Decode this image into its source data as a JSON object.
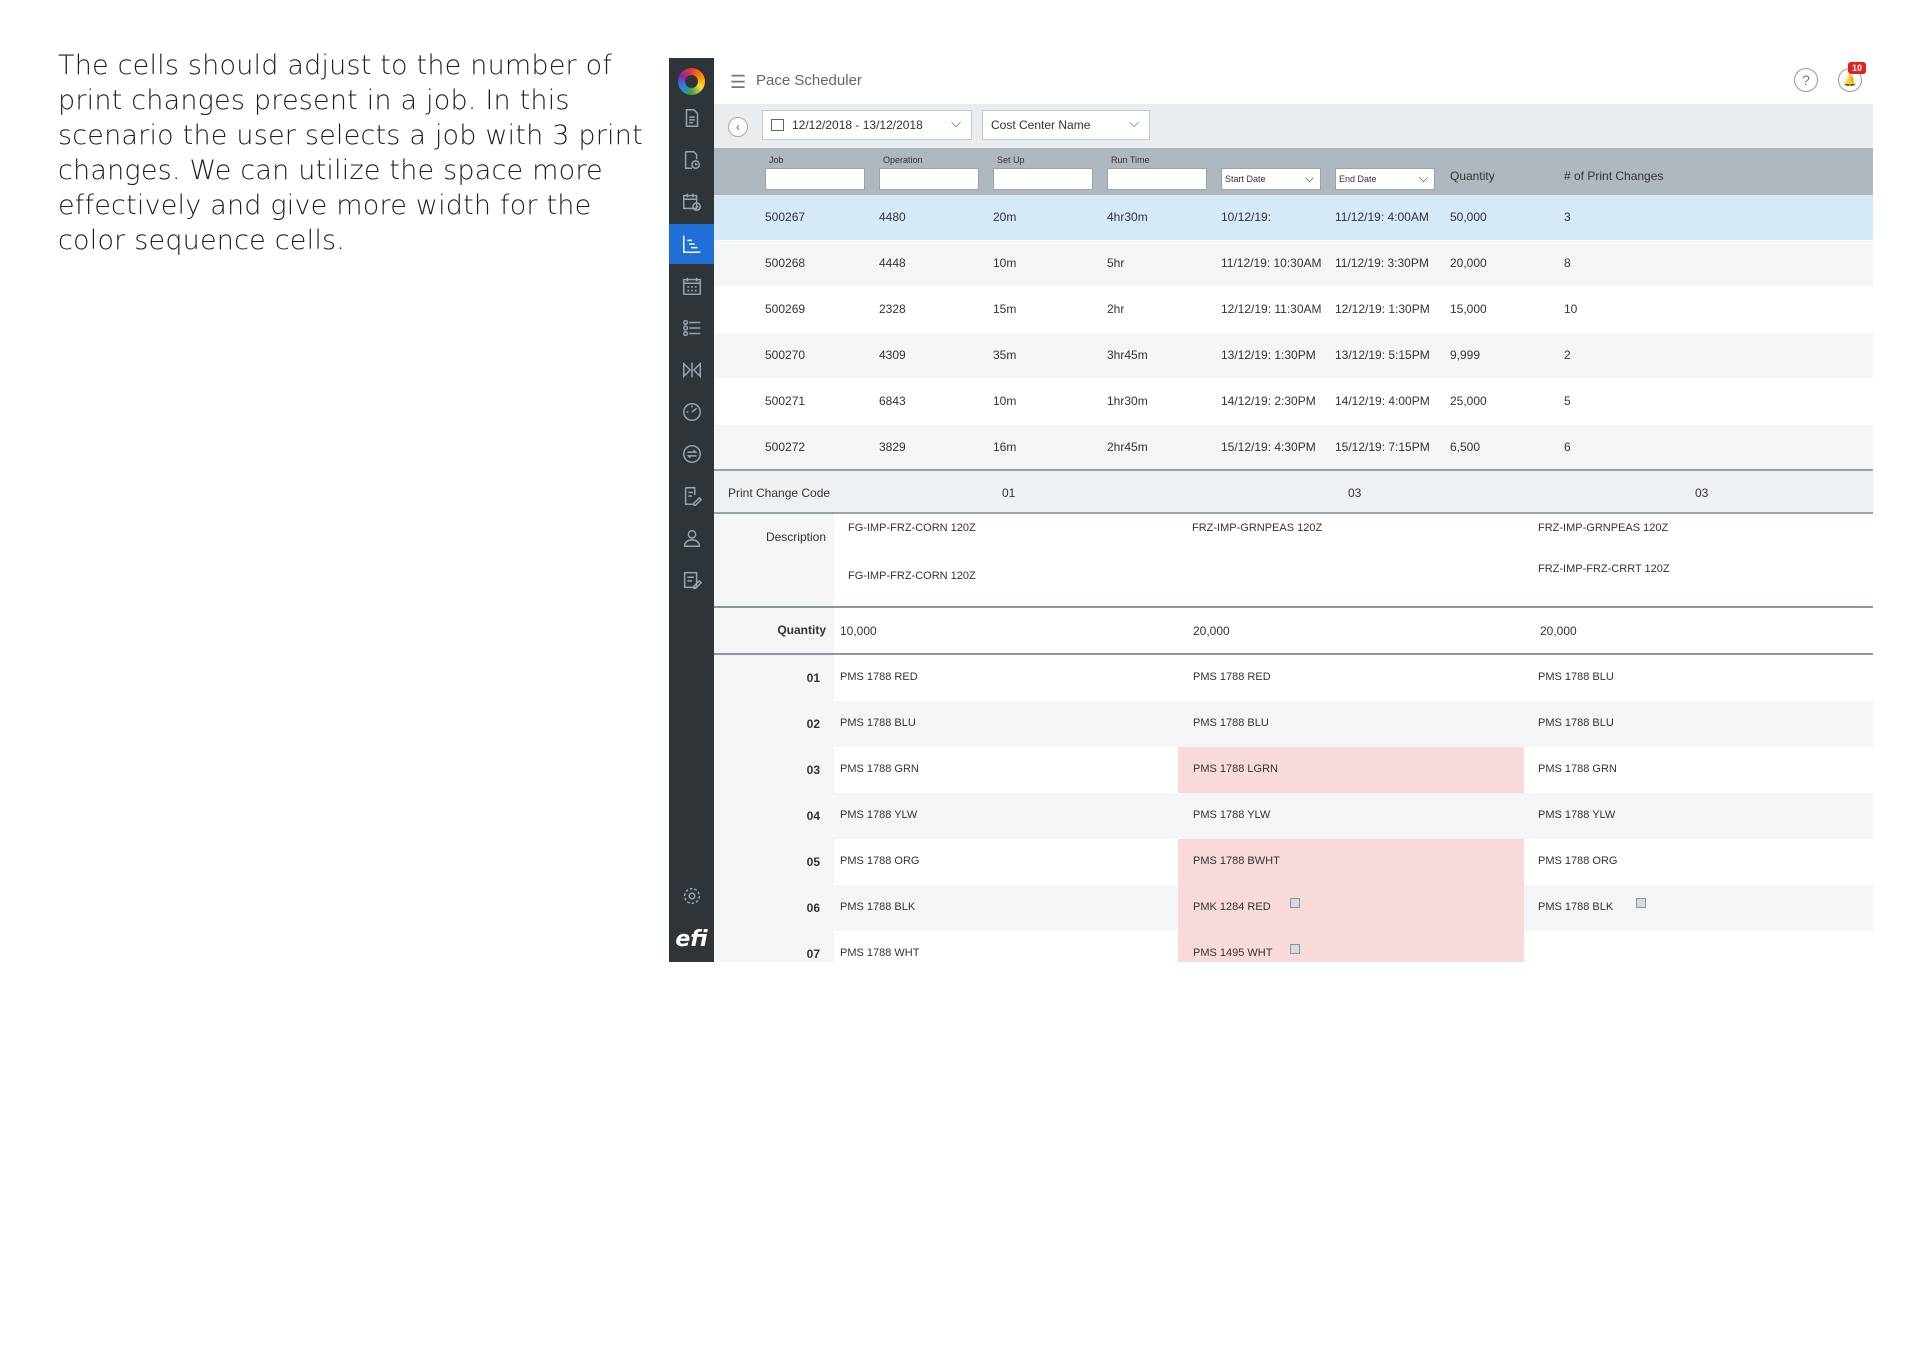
{
  "caption": "The cells should adjust to the number of print changes present in a job. In this scenario the user selects a job with 3 print changes. We can utilize the space more effectively and give more width for the color sequence cells.",
  "app": {
    "title": "Pace Scheduler",
    "notifications_count": "10",
    "help_glyph": "?",
    "back_glyph": "‹",
    "chevron_glyph": "⌵",
    "logo_text": "efi"
  },
  "filters": {
    "date_range": "12/12/2018 - 13/12/2018",
    "cost_center": "Cost Center Name"
  },
  "job_table": {
    "headers": {
      "job": "Job",
      "operation": "Operation",
      "setup": "Set Up",
      "runtime": "Run Time",
      "start_date": "Start Date",
      "end_date": "End Date",
      "quantity": "Quantity",
      "print_changes": "# of Print Changes"
    },
    "rows": [
      {
        "job": "500267",
        "operation": "4480",
        "setup": "20m",
        "runtime": "4hr30m",
        "start": "10/12/19:",
        "end": "11/12/19: 4:00AM",
        "quantity": "50,000",
        "changes": "3"
      },
      {
        "job": "500268",
        "operation": "4448",
        "setup": "10m",
        "runtime": "5hr",
        "start": "11/12/19: 10:30AM",
        "end": "11/12/19: 3:30PM",
        "quantity": "20,000",
        "changes": "8"
      },
      {
        "job": "500269",
        "operation": "2328",
        "setup": "15m",
        "runtime": "2hr",
        "start": "12/12/19: 11:30AM",
        "end": "12/12/19: 1:30PM",
        "quantity": "15,000",
        "changes": "10"
      },
      {
        "job": "500270",
        "operation": "4309",
        "setup": "35m",
        "runtime": "3hr45m",
        "start": "13/12/19: 1:30PM",
        "end": "13/12/19: 5:15PM",
        "quantity": "9,999",
        "changes": "2"
      },
      {
        "job": "500271",
        "operation": "6843",
        "setup": "10m",
        "runtime": "1hr30m",
        "start": "14/12/19: 2:30PM",
        "end": "14/12/19: 4:00PM",
        "quantity": "25,000",
        "changes": "5"
      },
      {
        "job": "500272",
        "operation": "3829",
        "setup": "16m",
        "runtime": "2hr45m",
        "start": "15/12/19: 4:30PM",
        "end": "15/12/19: 7:15PM",
        "quantity": "6,500",
        "changes": "6"
      }
    ]
  },
  "print_changes": {
    "code_label": "Print Change Code",
    "codes": [
      "01",
      "03",
      "03"
    ],
    "description_label": "Description",
    "descriptions": [
      [
        "FG-IMP-FRZ-CORN 120Z",
        "FG-IMP-FRZ-CORN 120Z"
      ],
      [
        "FRZ-IMP-GRNPEAS 120Z"
      ],
      [
        "FRZ-IMP-GRNPEAS 120Z",
        "FRZ-IMP-FRZ-CRRT 120Z"
      ]
    ],
    "quantity_label": "Quantity",
    "quantities": [
      "10,000",
      "20,000",
      "20,000"
    ],
    "sequence": [
      {
        "num": "01",
        "cells": [
          "PMS 1788 RED",
          "PMS 1788 RED",
          "PMS 1788 BLU"
        ]
      },
      {
        "num": "02",
        "cells": [
          "PMS 1788 BLU",
          "PMS 1788 BLU",
          "PMS 1788 BLU"
        ]
      },
      {
        "num": "03",
        "cells": [
          "PMS 1788 GRN",
          "PMS 1788 LGRN",
          "PMS 1788 GRN"
        ]
      },
      {
        "num": "04",
        "cells": [
          "PMS 1788 YLW",
          "PMS 1788 YLW",
          "PMS 1788 YLW"
        ]
      },
      {
        "num": "05",
        "cells": [
          "PMS 1788 ORG",
          "PMS 1788 BWHT",
          "PMS 1788 ORG"
        ]
      },
      {
        "num": "06",
        "cells": [
          "PMS 1788 BLK",
          "PMK 1284 RED",
          "PMS 1788 BLK"
        ]
      },
      {
        "num": "07",
        "cells": [
          "PMS 1788 WHT",
          "PMS 1495 WHT",
          ""
        ]
      }
    ],
    "changed_cells": [
      [
        2,
        1
      ],
      [
        4,
        1
      ],
      [
        5,
        1
      ],
      [
        6,
        1
      ]
    ],
    "copy_icon_cells": [
      [
        5,
        1
      ],
      [
        5,
        2
      ],
      [
        6,
        1
      ]
    ]
  },
  "colors": {
    "sidebar_bg": "#2f3439",
    "sidebar_active": "#1f6fd6",
    "header_bg": "#b0b8bf",
    "selected_row": "#d5e9f7",
    "changed_cell": "#f9dada",
    "badge": "#e5211d"
  }
}
